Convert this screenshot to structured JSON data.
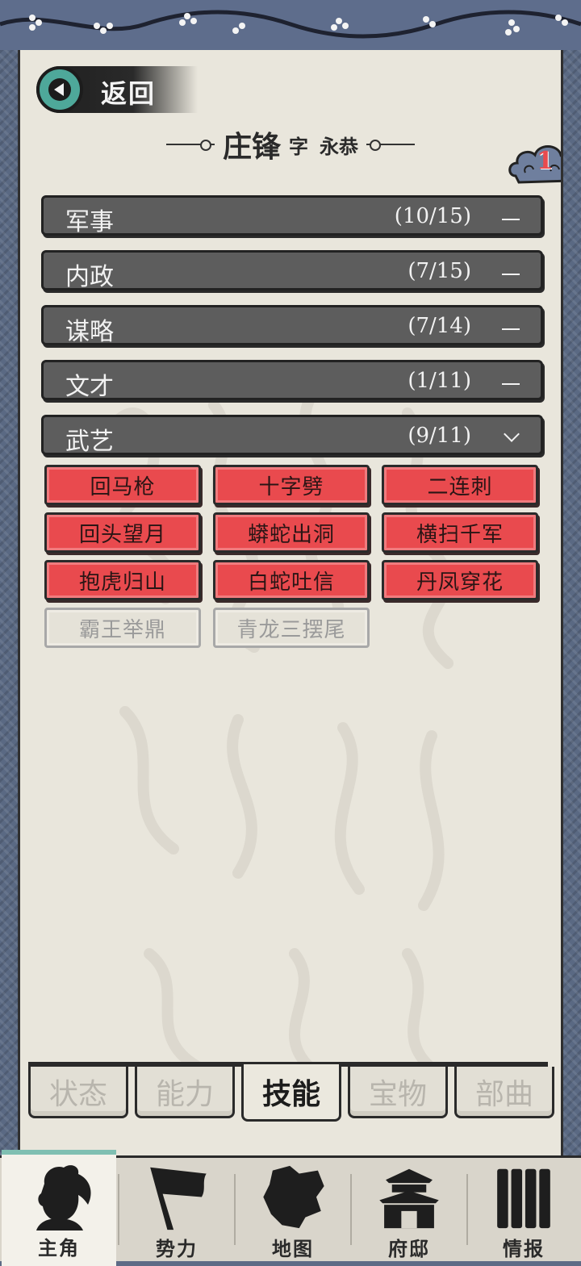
{
  "header": {
    "back_label": "返回"
  },
  "character": {
    "name": "庄锋",
    "zi_label": "字",
    "style_name": "永恭"
  },
  "badge": {
    "count": "1"
  },
  "categories": [
    {
      "label": "军事",
      "count": "(10/15)",
      "state": "collapsed"
    },
    {
      "label": "内政",
      "count": "(7/15)",
      "state": "collapsed"
    },
    {
      "label": "谋略",
      "count": "(7/14)",
      "state": "collapsed"
    },
    {
      "label": "文才",
      "count": "(1/11)",
      "state": "collapsed"
    },
    {
      "label": "武艺",
      "count": "(9/11)",
      "state": "expanded"
    }
  ],
  "skills": [
    {
      "label": "回马枪",
      "learned": true
    },
    {
      "label": "十字劈",
      "learned": true
    },
    {
      "label": "二连刺",
      "learned": true
    },
    {
      "label": "回头望月",
      "learned": true
    },
    {
      "label": "蟒蛇出洞",
      "learned": true
    },
    {
      "label": "横扫千军",
      "learned": true
    },
    {
      "label": "抱虎归山",
      "learned": true
    },
    {
      "label": "白蛇吐信",
      "learned": true
    },
    {
      "label": "丹凤穿花",
      "learned": true
    },
    {
      "label": "霸王举鼎",
      "learned": false
    },
    {
      "label": "青龙三摆尾",
      "learned": false
    }
  ],
  "tabs": [
    {
      "label": "状态",
      "active": false
    },
    {
      "label": "能力",
      "active": false
    },
    {
      "label": "技能",
      "active": true
    },
    {
      "label": "宝物",
      "active": false
    },
    {
      "label": "部曲",
      "active": false
    }
  ],
  "nav": [
    {
      "label": "主角",
      "icon": "warrior-portrait-icon",
      "active": true
    },
    {
      "label": "势力",
      "icon": "banner-flag-icon",
      "active": false
    },
    {
      "label": "地图",
      "icon": "map-territory-icon",
      "active": false
    },
    {
      "label": "府邸",
      "icon": "mansion-gate-icon",
      "active": false
    },
    {
      "label": "情报",
      "icon": "bamboo-scroll-icon",
      "active": false
    }
  ],
  "colors": {
    "skill_learned": "#e94a4e",
    "category_bar": "#5d5d5d",
    "paper": "#e9e6dc",
    "frame": "#5d6b86",
    "back_button": "#4ea89a"
  }
}
